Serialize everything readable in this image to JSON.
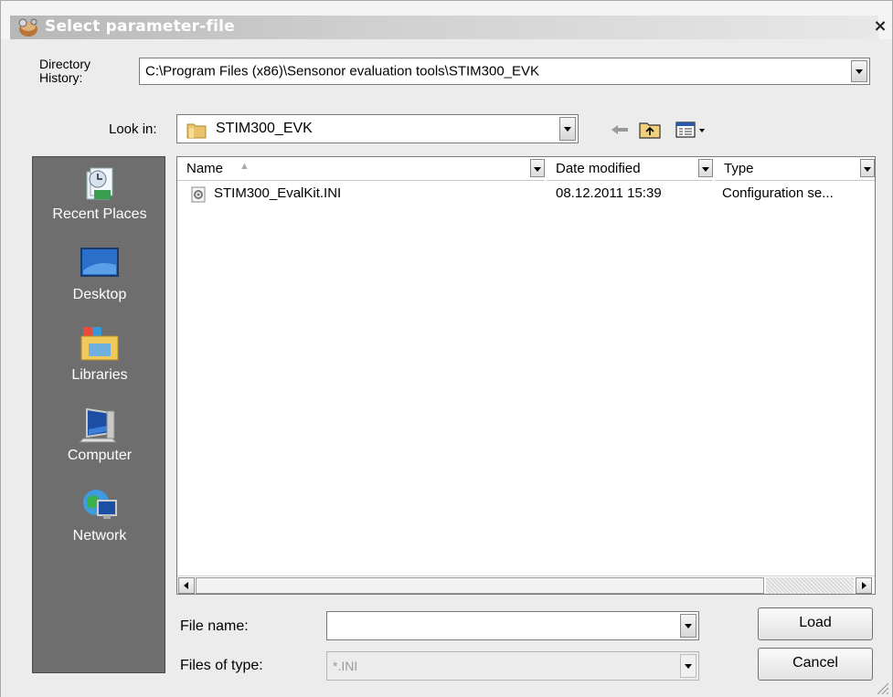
{
  "window": {
    "title": "Select parameter-file",
    "close_glyph": "×"
  },
  "directory_history": {
    "label": "Directory\nHistory:",
    "label_line1": "Directory",
    "label_line2": "History:",
    "value": "C:\\Program Files (x86)\\Sensonor evaluation tools\\STIM300_EVK"
  },
  "look_in": {
    "label": "Look in:",
    "value": "STIM300_EVK",
    "folder_icon": "folder-icon"
  },
  "toolbar": {
    "icons": [
      "back-arrow-icon",
      "up-folder-icon",
      "view-menu-icon"
    ]
  },
  "places": [
    {
      "label": "Recent Places",
      "icon": "recent-places-icon"
    },
    {
      "label": "Desktop",
      "icon": "desktop-icon"
    },
    {
      "label": "Libraries",
      "icon": "libraries-icon"
    },
    {
      "label": "Computer",
      "icon": "computer-icon"
    },
    {
      "label": "Network",
      "icon": "network-icon"
    }
  ],
  "file_list": {
    "columns": [
      "Name",
      "Date modified",
      "Type"
    ],
    "sort_indicator": "▲",
    "rows": [
      {
        "name": "STIM300_EvalKit.INI",
        "date_modified": "08.12.2011 15:39",
        "type": "Configuration se..."
      }
    ]
  },
  "file_name": {
    "label": "File name:",
    "value": ""
  },
  "files_of_type": {
    "label": "Files of type:",
    "value": "*.INI"
  },
  "buttons": {
    "load": "Load",
    "cancel": "Cancel"
  }
}
